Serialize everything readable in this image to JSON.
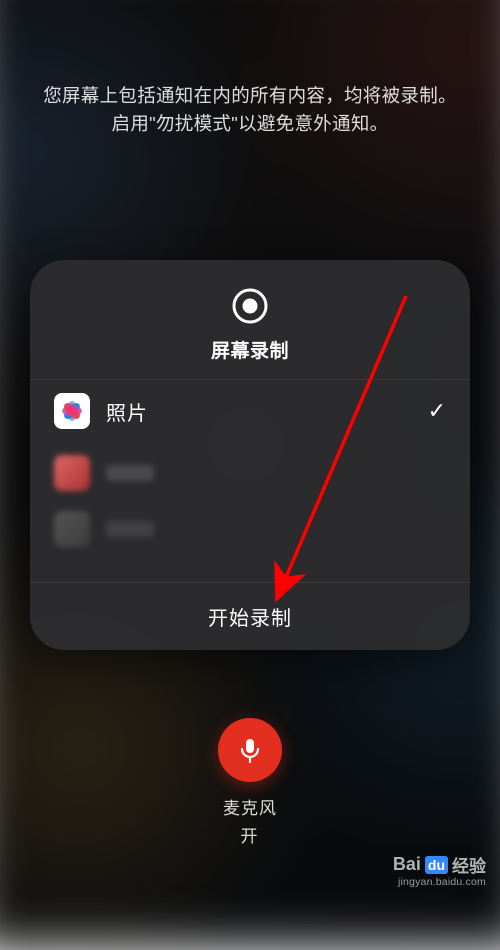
{
  "instruction_text": "您屏幕上包括通知在内的所有内容，均将被录制。启用\"勿扰模式\"以避免意外通知。",
  "panel": {
    "title": "屏幕录制",
    "apps": {
      "selected": {
        "label": "照片"
      }
    },
    "start_label": "开始录制"
  },
  "microphone": {
    "label": "麦克风",
    "status": "开"
  },
  "watermark": {
    "brand_prefix": "Bai",
    "brand_box": "du",
    "brand_suffix": "经验",
    "url": "jingyan.baidu.com"
  }
}
